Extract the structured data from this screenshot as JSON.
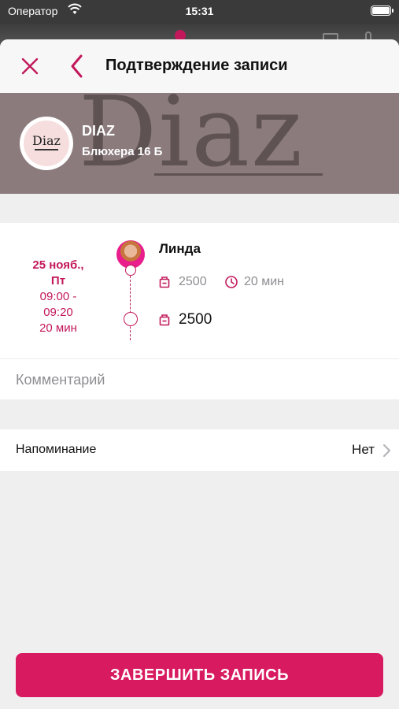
{
  "status_bar": {
    "carrier": "Оператор",
    "time": "15:31"
  },
  "colors": {
    "accent": "#d81b60",
    "accent_text": "#c2185b",
    "secondary_text": "#8e8e93"
  },
  "header": {
    "title": "Подтверждение записи",
    "close_icon": "close-icon",
    "back_icon": "chevron-left-icon"
  },
  "salon": {
    "logo_text": "Diaz",
    "name": "DIAZ",
    "address": "Блюхера 16 Б"
  },
  "appointment": {
    "date": "25 нояб.,",
    "weekday": "Пт",
    "time_start": "09:00 -",
    "time_end": "09:20",
    "duration_short": "20 мин",
    "master": "Линда",
    "service_price": "2500",
    "service_duration": "20 мин",
    "total_price": "2500"
  },
  "comment": {
    "placeholder": "Комментарий"
  },
  "reminder": {
    "label": "Напоминание",
    "value": "Нет"
  },
  "actions": {
    "finish_label": "ЗАВЕРШИТЬ ЗАПИСЬ"
  }
}
